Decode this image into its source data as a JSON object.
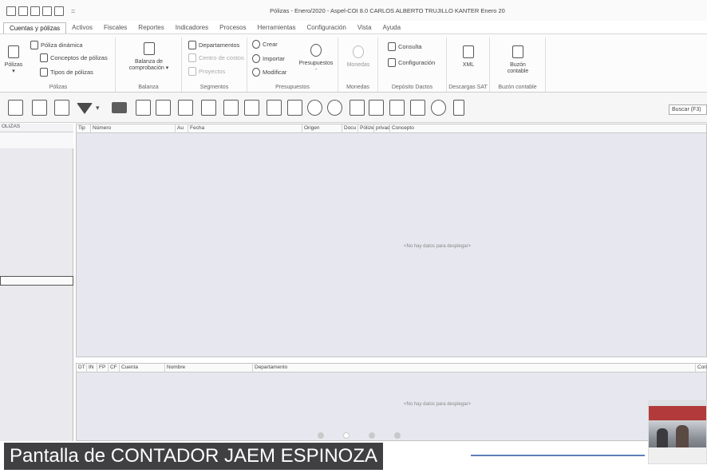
{
  "window": {
    "title": "Pólizas - Enero/2020 - Aspel-COI 8.0 CARLOS ALBERTO TRUJILLO KANTER Enero 20",
    "qat_separator": "="
  },
  "menu": {
    "tabs": [
      "Cuentas y pólizas",
      "Activos",
      "Fiscales",
      "Reportes",
      "Indicadores",
      "Procesos",
      "Herramientas",
      "Configuración",
      "Vista",
      "Ayuda"
    ],
    "active_index": 0
  },
  "ribbon": {
    "polizas": {
      "group_label": "Pólizas",
      "big_button": "Pólizas",
      "items": [
        "Póliza dinámica",
        "Conceptos de pólizas",
        "Tipos de pólizas"
      ]
    },
    "balanza": {
      "group_label": "Balanza",
      "big_button_line1": "Balanza de",
      "big_button_line2": "comprobación"
    },
    "segmentos": {
      "group_label": "Segmentos",
      "items": [
        "Departamentos",
        "Centro de costos",
        "Proyectos"
      ]
    },
    "presupuestos": {
      "group_label": "Presupuestos",
      "items": [
        "Crear",
        "Importar",
        "Modificar"
      ],
      "big_button": "Presupuestos"
    },
    "monedas": {
      "group_label": "Monedas",
      "big_button": "Monedas"
    },
    "deposito": {
      "group_label": "Depósito Dactos",
      "items": [
        "Consulta",
        "Configuración"
      ]
    },
    "descargas": {
      "group_label": "Descargas SAT",
      "big_button": "XML"
    },
    "buzon": {
      "group_label": "Buzón contable",
      "big_button_line1": "Buzón",
      "big_button_line2": "contable"
    }
  },
  "toolbar": {
    "search_placeholder": "Buscar (F3)"
  },
  "left_panel": {
    "header": "OLIZAS"
  },
  "top_grid": {
    "columns": [
      "Tip",
      "Número",
      "Au",
      "Fecha",
      "Origen",
      "Docu",
      "Pólize",
      "privad",
      "Concepto"
    ],
    "empty_message": "<No hay datos para desplegar>"
  },
  "bottom_grid": {
    "columns": [
      "DT",
      "IN",
      "FP",
      "CF",
      "Cuenta",
      "Nombre",
      "Departamento",
      "Con"
    ],
    "empty_message": "<No hay datos para desplegar>"
  },
  "overlay": {
    "caption": "Pantalla de CONTADOR JAEM ESPINOZA"
  }
}
